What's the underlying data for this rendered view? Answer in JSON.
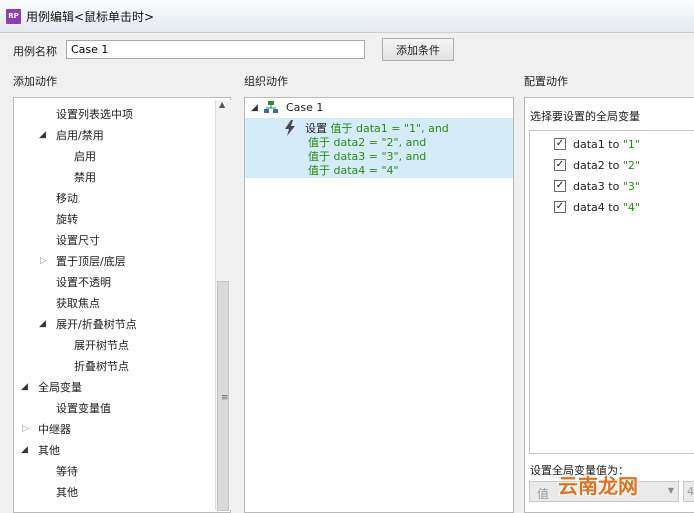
{
  "window": {
    "icon_text": "RP",
    "title": "用例编辑<鼠标单击时>"
  },
  "case_name": {
    "label": "用例名称",
    "value": "Case 1",
    "add_condition_label": "添加条件"
  },
  "sections": {
    "add_actions": "添加动作",
    "organize_actions": "组织动作",
    "configure_actions": "配置动作"
  },
  "add_actions_tree": [
    {
      "label": "设置列表选中项"
    },
    {
      "label": "启用/禁用",
      "expanded": true
    },
    {
      "label": "启用"
    },
    {
      "label": "禁用"
    },
    {
      "label": "移动"
    },
    {
      "label": "旋转"
    },
    {
      "label": "设置尺寸"
    },
    {
      "label": "置于顶层/底层",
      "expanded": false
    },
    {
      "label": "设置不透明"
    },
    {
      "label": "获取焦点"
    },
    {
      "label": "展开/折叠树节点",
      "expanded": true
    },
    {
      "label": "展开树节点"
    },
    {
      "label": "折叠树节点"
    },
    {
      "label": "全局变量",
      "expanded": true
    },
    {
      "label": "设置变量值"
    },
    {
      "label": "中继器",
      "expanded": false
    },
    {
      "label": "其他",
      "expanded": true
    },
    {
      "label": "等待"
    },
    {
      "label": "其他"
    }
  ],
  "organize": {
    "case_label": "Case 1",
    "action_keyword": "设置",
    "action_lines": [
      "值于 data1 = \"1\", and",
      "值于 data2 = \"2\", and",
      "值于 data3 = \"3\", and",
      "值于 data4 = \"4\""
    ]
  },
  "configure": {
    "prompt": "选择要设置的全局变量",
    "variables": [
      {
        "name": "data1",
        "to": "to",
        "value": "\"1\"",
        "checked": true
      },
      {
        "name": "data2",
        "to": "to",
        "value": "\"2\"",
        "checked": true
      },
      {
        "name": "data3",
        "to": "to",
        "value": "\"3\"",
        "checked": true
      },
      {
        "name": "data4",
        "to": "to",
        "value": "\"4\"",
        "checked": true
      }
    ],
    "set_value_label": "设置全局变量值为：",
    "value_type_selected": "值",
    "value_input": "4"
  },
  "watermark": "云南龙网",
  "colors": {
    "selection": "#d3ecf8",
    "value_text": "#2b8a12",
    "watermark": "#e3701a"
  }
}
